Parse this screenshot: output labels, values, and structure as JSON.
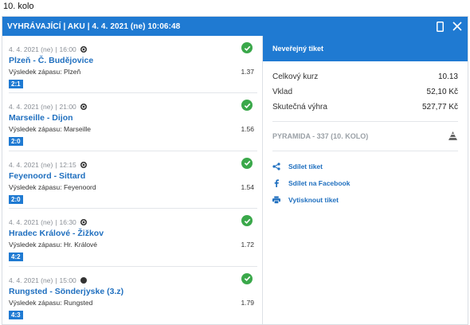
{
  "page": {
    "round_label": "10. kolo"
  },
  "ticket": {
    "header_title": "VYHRÁVAJÍCÍ | AKU | 4. 4. 2021 (ne) 10:06:48",
    "colors": {
      "accent": "#1f7ad2",
      "win": "#3aa84a",
      "link": "#1f6fbf"
    },
    "matches": [
      {
        "date": "4. 4. 2021 (ne)",
        "sep": "|",
        "time": "16:00",
        "sport_icon": "football-icon",
        "name": "Plzeň - Č. Budějovice",
        "result_label": "Výsledek zápasu: Plzeň",
        "odds": "1.37",
        "score": "2:1"
      },
      {
        "date": "4. 4. 2021 (ne)",
        "sep": "|",
        "time": "21:00",
        "sport_icon": "football-icon",
        "name": "Marseille - Dijon",
        "result_label": "Výsledek zápasu: Marseille",
        "odds": "1.56",
        "score": "2:0"
      },
      {
        "date": "4. 4. 2021 (ne)",
        "sep": "|",
        "time": "12:15",
        "sport_icon": "football-icon",
        "name": "Feyenoord - Sittard",
        "result_label": "Výsledek zápasu: Feyenoord",
        "odds": "1.54",
        "score": "2:0"
      },
      {
        "date": "4. 4. 2021 (ne)",
        "sep": "|",
        "time": "16:30",
        "sport_icon": "football-icon",
        "name": "Hradec Králové - Žižkov",
        "result_label": "Výsledek zápasu: Hr. Králové",
        "odds": "1.72",
        "score": "4:2"
      },
      {
        "date": "4. 4. 2021 (ne)",
        "sep": "|",
        "time": "15:00",
        "sport_icon": "hockey-puck-icon",
        "name": "Rungsted - Sönderjyske (3.z)",
        "result_label": "Výsledek zápasu: Rungsted",
        "odds": "1.79",
        "score": "4:3"
      }
    ],
    "private_label": "Neveřejný tiket",
    "summary": [
      {
        "label": "Celkový kurz",
        "value": "10.13"
      },
      {
        "label": "Vklad",
        "value": "52,10 Kč"
      },
      {
        "label": "Skutečná výhra",
        "value": "527,77 Kč"
      }
    ],
    "pyramid_label": "PYRAMIDA - 337 (10. KOLO)",
    "actions": [
      {
        "icon": "share-icon",
        "label": "Sdílet tiket"
      },
      {
        "icon": "facebook-icon",
        "label": "Sdílet na Facebook"
      },
      {
        "icon": "print-icon",
        "label": "Vytisknout tiket"
      }
    ]
  }
}
